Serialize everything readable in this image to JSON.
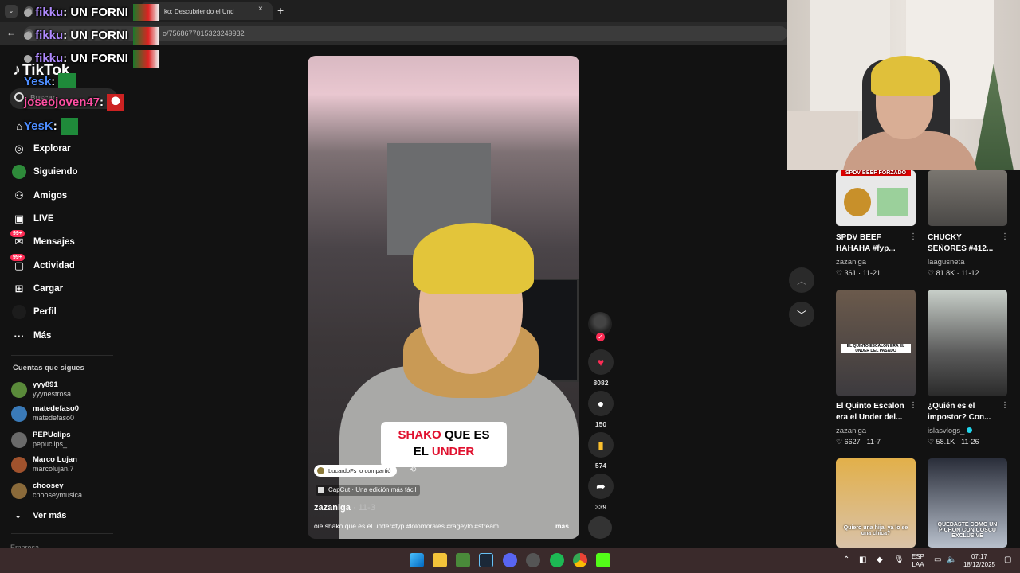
{
  "browser": {
    "tab_title": "ko: Descubriendo el Und",
    "tab_close": "×",
    "new_tab": "+",
    "tabs_menu": "⌄",
    "back": "←",
    "url": "o/7568677015323249932"
  },
  "chat_overlay": [
    {
      "user": "fikku",
      "message": ": UN FORNI",
      "color": "#b08aff"
    },
    {
      "user": "fikku",
      "message": ": UN FORNI",
      "color": "#b08aff"
    },
    {
      "user": "fikku",
      "message": ": UN FORNI",
      "color": "#b08aff"
    },
    {
      "user": "Yesk",
      "message": ":",
      "color": "#4d8dff"
    },
    {
      "user": "joseojoven47",
      "message": ":",
      "color": "#ff4fa3"
    },
    {
      "user": "YesK",
      "message": ":",
      "color": "#4d8dff"
    }
  ],
  "sidebar": {
    "logo": "TikTok",
    "search_placeholder": "Buscar",
    "nav": [
      {
        "label": "Explorar",
        "icon": "compass-icon"
      },
      {
        "label": "Siguiendo",
        "icon": "following-avatar-icon"
      },
      {
        "label": "Amigos",
        "icon": "friends-icon"
      },
      {
        "label": "LIVE",
        "icon": "live-icon"
      },
      {
        "label": "Mensajes",
        "icon": "messages-icon",
        "badge": "99+"
      },
      {
        "label": "Actividad",
        "icon": "activity-icon",
        "badge": "99+"
      },
      {
        "label": "Cargar",
        "icon": "upload-icon"
      },
      {
        "label": "Perfil",
        "icon": "profile-icon"
      },
      {
        "label": "Más",
        "icon": "more-icon"
      }
    ],
    "following_header": "Cuentas que sigues",
    "following": [
      {
        "name": "yyy891",
        "user": "yyynestrosa",
        "color": "#5a8a3a"
      },
      {
        "name": "matedefaso0",
        "user": "matedefaso0",
        "color": "#3a7ab8"
      },
      {
        "name": "PEPUclips",
        "user": "pepuclips_",
        "color": "#6a6a6a"
      },
      {
        "name": "Marco Lujan",
        "user": "marcolujan.7",
        "color": "#a0522d"
      },
      {
        "name": "choosey",
        "user": "chooseymusica",
        "color": "#8a6a3a"
      }
    ],
    "ver_mas": "Ver más",
    "cut_text": "Empresa"
  },
  "video": {
    "caption_part1": "SHAKO",
    "caption_part2": " QUE ES",
    "caption_part3": "EL ",
    "caption_part4": "UNDER",
    "shared_by": "LucardoFs lo compartió",
    "capcut": "CapCut · Una edición más fácil",
    "author": "zazaniga",
    "date": " · 11-3",
    "description": "oie shako que es el under#fyp #lolomorales #rageylo #stream ...",
    "more": "más"
  },
  "actions": {
    "likes": "8082",
    "comments": "150",
    "saves": "574",
    "shares": "339",
    "like_color": "#fe2c55",
    "save_color": "#fcc02d"
  },
  "grid": [
    {
      "title1": "SPDV BEEF",
      "title2": "HAHAHA #fyp...",
      "author": "zazaniga",
      "likes": "361",
      "date": "11-21",
      "thumb_text": "SPDV BEEF FORZADO"
    },
    {
      "title1": "CHUCKY",
      "title2": "SEÑORES #412...",
      "author": "laagusneta",
      "likes": "81.8K",
      "date": "11-12",
      "thumb_text": ""
    },
    {
      "title1": "El Quinto Escalon",
      "title2": "era el Under del...",
      "author": "zazaniga",
      "likes": "6627",
      "date": "11-7",
      "thumb_text": "EL QUINTO ESCALON ERA EL UNDER DEL PASADO"
    },
    {
      "title1": "¿Quién es el",
      "title2": "impostor? Con...",
      "author": "islasvlogs_",
      "likes": "58.1K",
      "date": "11-26",
      "thumb_text": ""
    },
    {
      "title1": "",
      "title2": "",
      "author": "",
      "likes": "",
      "date": "",
      "thumb_text": "Quiero una hija, ya lo se una chica?"
    },
    {
      "title1": "",
      "title2": "",
      "author": "",
      "likes": "",
      "date": "",
      "thumb_text": "QUEDASTE COMO UN PICHON CON COSCU EXCLUSIVE"
    }
  ],
  "tray": {
    "lang1": "ESP",
    "lang2": "LAA",
    "time": "07:17",
    "date": "18/12/2025"
  }
}
